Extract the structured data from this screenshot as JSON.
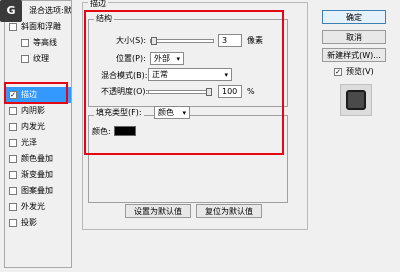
{
  "window": {
    "logo_text": "G"
  },
  "style_list": {
    "header": "混合选项:默认",
    "items": [
      {
        "label": "斜面和浮雕",
        "checked": false
      },
      {
        "label": "等高线",
        "checked": false
      },
      {
        "label": "纹理",
        "checked": false
      },
      {
        "label": "描边",
        "checked": true,
        "selected": true
      },
      {
        "label": "内阴影",
        "checked": false
      },
      {
        "label": "内发光",
        "checked": false
      },
      {
        "label": "光泽",
        "checked": false
      },
      {
        "label": "颜色叠加",
        "checked": false
      },
      {
        "label": "渐变叠加",
        "checked": false
      },
      {
        "label": "图案叠加",
        "checked": false
      },
      {
        "label": "外发光",
        "checked": false
      },
      {
        "label": "投影",
        "checked": false
      }
    ],
    "check_mark": "✓"
  },
  "stroke_panel": {
    "title": "描边",
    "structure": {
      "title": "结构",
      "size_label": "大小(S):",
      "size_value": "3",
      "size_unit": "像素",
      "size_slider_value": 3,
      "size_slider_max": 250,
      "position_label": "位置(P):",
      "position_value": "外部",
      "blend_mode_label": "混合模式(B):",
      "blend_mode_value": "正常",
      "opacity_label": "不透明度(O):",
      "opacity_value": "100",
      "opacity_unit": "%",
      "opacity_slider_percent": 100
    },
    "fill": {
      "fill_type_label": "填充类型(F):",
      "fill_type_value": "颜色",
      "color_label": "颜色:",
      "color_hex": "#000000"
    },
    "set_default_button": "设置为默认值",
    "reset_default_button": "复位为默认值"
  },
  "actions": {
    "ok_button": "确定",
    "cancel_button": "取消",
    "new_style_button": "新建样式(W)...",
    "preview_label": "预览(V)",
    "preview_checked": true
  },
  "colors": {
    "selection": "#3399ff",
    "highlight": "#e30613",
    "panel_bg": "#f0f0f0"
  }
}
